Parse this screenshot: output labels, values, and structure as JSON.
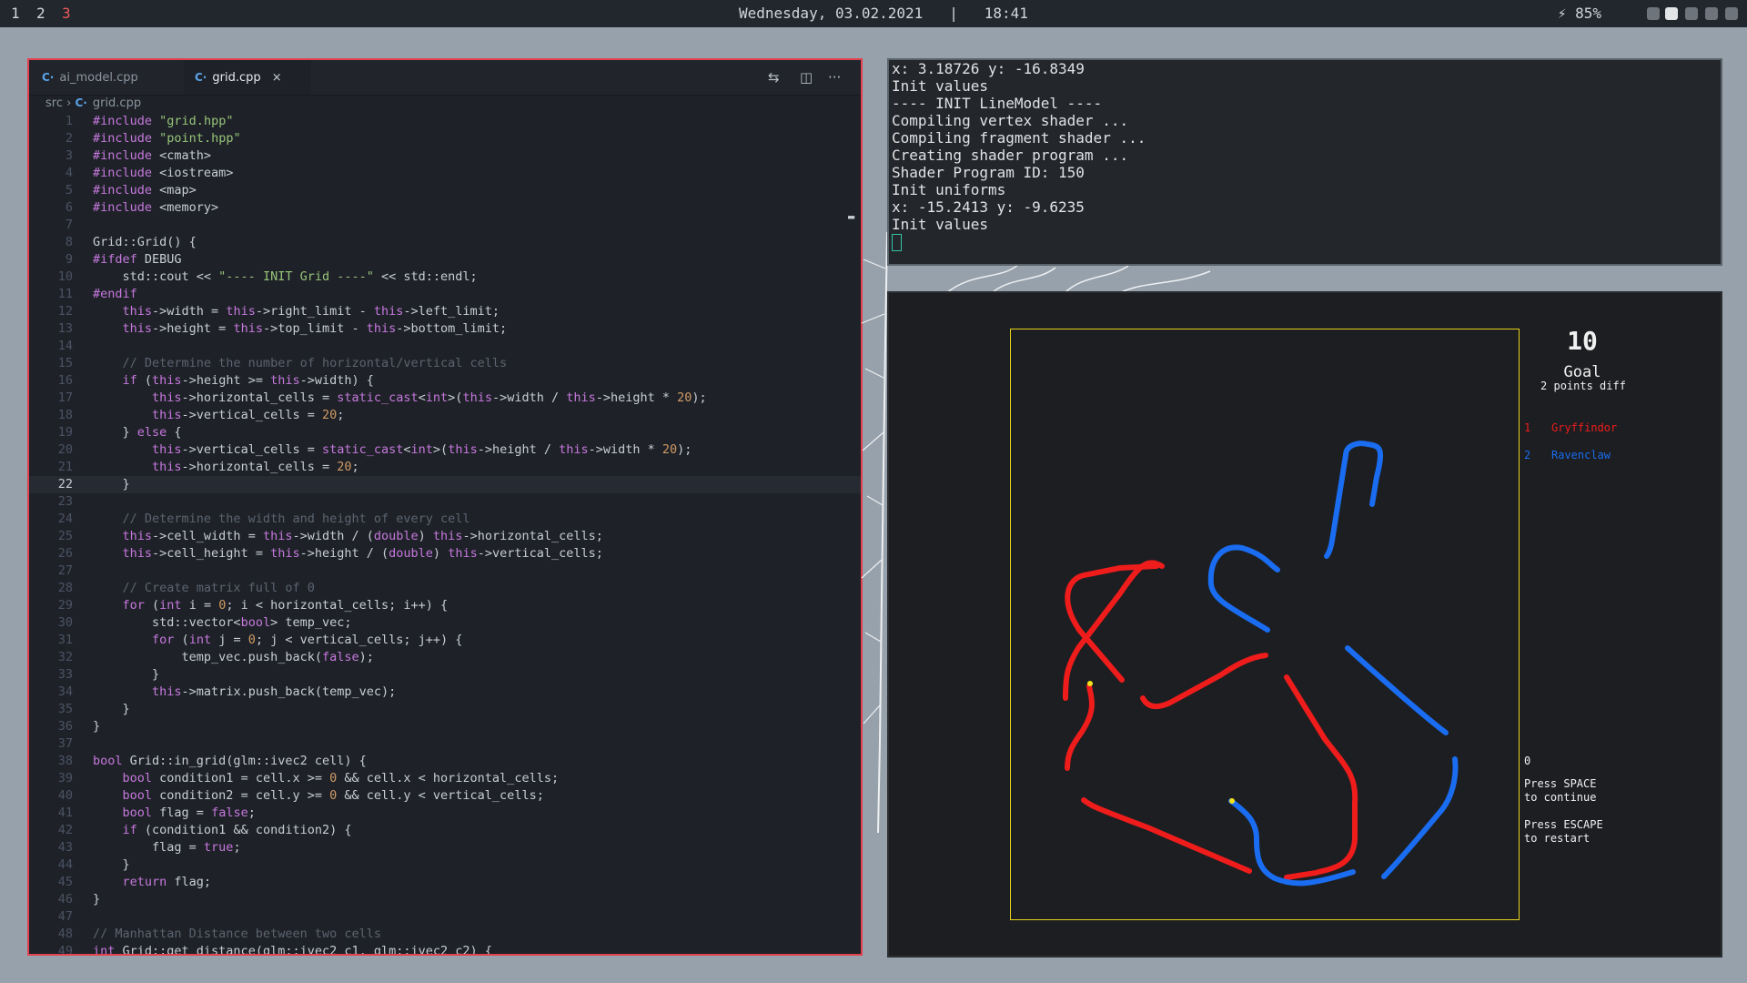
{
  "topbar": {
    "workspaces": [
      "1",
      "2",
      "3"
    ],
    "active_workspace": "3",
    "date": "Wednesday, 03.02.2021",
    "separator": "|",
    "time": "18:41",
    "battery": "85%",
    "tray_icons": [
      "battery-icon",
      "shield-icon",
      "speaker-muted-icon",
      "wifi-icon",
      "vpn-icon",
      "pen-icon"
    ]
  },
  "editor": {
    "tabs": [
      {
        "label": "ai_model.cpp",
        "icon": "cpp-file-icon",
        "active": false
      },
      {
        "label": "grid.cpp",
        "icon": "cpp-file-icon",
        "active": true,
        "close": "×"
      }
    ],
    "actions": {
      "compare": "⇆",
      "split": "◫",
      "more": "···"
    },
    "breadcrumb": {
      "folder": "src",
      "sep": "›",
      "file": "grid.cpp"
    },
    "current_line": 22,
    "lines": [
      "#include \"grid.hpp\"",
      "#include \"point.hpp\"",
      "#include <cmath>",
      "#include <iostream>",
      "#include <map>",
      "#include <memory>",
      "",
      "Grid::Grid() {",
      "#ifdef DEBUG",
      "    std::cout << \"---- INIT Grid ----\" << std::endl;",
      "#endif",
      "    this->width = this->right_limit - this->left_limit;",
      "    this->height = this->top_limit - this->bottom_limit;",
      "",
      "    // Determine the number of horizontal/vertical cells",
      "    if (this->height >= this->width) {",
      "        this->horizontal_cells = static_cast<int>(this->width / this->height * 20);",
      "        this->vertical_cells = 20;",
      "    } else {",
      "        this->vertical_cells = static_cast<int>(this->height / this->width * 20);",
      "        this->horizontal_cells = 20;",
      "    }",
      "",
      "    // Determine the width and height of every cell",
      "    this->cell_width = this->width / (double) this->horizontal_cells;",
      "    this->cell_height = this->height / (double) this->vertical_cells;",
      "",
      "    // Create matrix full of 0",
      "    for (int i = 0; i < horizontal_cells; i++) {",
      "        std::vector<bool> temp_vec;",
      "        for (int j = 0; j < vertical_cells; j++) {",
      "            temp_vec.push_back(false);",
      "        }",
      "        this->matrix.push_back(temp_vec);",
      "    }",
      "}",
      "",
      "bool Grid::in_grid(glm::ivec2 cell) {",
      "    bool condition1 = cell.x >= 0 && cell.x < horizontal_cells;",
      "    bool condition2 = cell.y >= 0 && cell.y < vertical_cells;",
      "    bool flag = false;",
      "    if (condition1 && condition2) {",
      "        flag = true;",
      "    }",
      "    return flag;",
      "}",
      "",
      "// Manhattan Distance between two cells",
      "int Grid::get_distance(glm::ivec2 c1, glm::ivec2 c2) {"
    ]
  },
  "terminal": {
    "lines": [
      "x: 3.18726 y: -16.8349",
      "Init values",
      "---- INIT LineModel ----",
      "Compiling vertex shader ...",
      "Compiling fragment shader ...",
      "Creating shader program ...",
      "Shader Program ID: 150",
      "Init uniforms",
      "x: -15.2413 y: -9.6235",
      "Init values"
    ]
  },
  "game": {
    "score": "10",
    "goal_label": "Goal",
    "goal_diff": "2 points diff",
    "teams": [
      {
        "num": "1",
        "name": "Gryffindor",
        "color": "#ef1c1c"
      },
      {
        "num": "2",
        "name": "Ravenclaw",
        "color": "#1a6cf0"
      }
    ],
    "counter": "0",
    "msg_continue": "Press SPACE\nto continue",
    "msg_restart": "Press ESCAPE\nto restart",
    "board_border_color": "#e7d21c"
  }
}
